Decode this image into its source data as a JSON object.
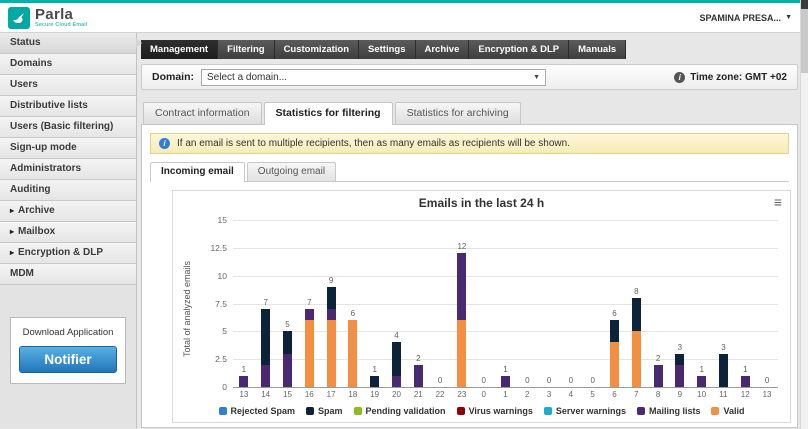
{
  "brand": {
    "name": "Parla",
    "tagline": "Secure Cloud Email",
    "account": "SPAMINA PRESA...",
    "accent": "#00b2ab"
  },
  "icons": {
    "caret_down": "▼",
    "expand_arrow": "▸",
    "chart_menu": "≡",
    "info": "i"
  },
  "sidebar": {
    "items": [
      {
        "label": "Status"
      },
      {
        "label": "Domains"
      },
      {
        "label": "Users"
      },
      {
        "label": "Distributive lists"
      },
      {
        "label": "Users (Basic filtering)"
      },
      {
        "label": "Sign-up mode"
      },
      {
        "label": "Administrators"
      },
      {
        "label": "Auditing"
      },
      {
        "label": "Archive"
      },
      {
        "label": "Mailbox"
      },
      {
        "label": "Encryption & DLP"
      },
      {
        "label": "MDM"
      }
    ],
    "download": {
      "title": "Download Application",
      "button": "Notifier"
    }
  },
  "nav": {
    "tabs": [
      {
        "label": "Management"
      },
      {
        "label": "Filtering"
      },
      {
        "label": "Customization"
      },
      {
        "label": "Settings"
      },
      {
        "label": "Archive"
      },
      {
        "label": "Encryption & DLP"
      },
      {
        "label": "Manuals"
      }
    ]
  },
  "domain_bar": {
    "label": "Domain:",
    "select_value": "Select a domain...",
    "timezone": "Time zone: GMT +02"
  },
  "tabs": [
    {
      "label": "Contract information"
    },
    {
      "label": "Statistics for filtering"
    },
    {
      "label": "Statistics for archiving"
    }
  ],
  "notice": "If an email is sent to multiple recipients, then as many emails as recipients will be shown.",
  "subtabs": [
    {
      "label": "Incoming email"
    },
    {
      "label": "Outgoing email"
    }
  ],
  "chart_data": {
    "type": "bar",
    "stacked": true,
    "title": "Emails in the last 24 h",
    "xlabel": "",
    "ylabel": "Total of analyzed emails",
    "ylim": [
      0,
      15
    ],
    "yticks": [
      "0",
      "2.5",
      "5",
      "7.5",
      "10",
      "12.5",
      "15"
    ],
    "grid": true,
    "legend_position": "bottom",
    "categories": [
      "13",
      "14",
      "15",
      "16",
      "17",
      "18",
      "19",
      "20",
      "21",
      "22",
      "23",
      "0",
      "1",
      "2",
      "3",
      "4",
      "5",
      "6",
      "7",
      "8",
      "9",
      "10",
      "11",
      "12",
      "13"
    ],
    "totals": [
      1,
      7,
      5,
      7,
      9,
      6,
      1,
      4,
      2,
      0,
      12,
      0,
      1,
      0,
      0,
      0,
      0,
      6,
      8,
      2,
      3,
      1,
      3,
      1,
      0
    ],
    "series": [
      {
        "name": "Rejected Spam",
        "color": "#2f7ed8",
        "values": [
          0,
          0,
          0,
          0,
          0,
          0,
          0,
          0,
          0,
          0,
          0,
          0,
          0,
          0,
          0,
          0,
          0,
          0,
          0,
          0,
          0,
          0,
          0,
          0,
          0
        ]
      },
      {
        "name": "Spam",
        "color": "#0d233a",
        "values": [
          0,
          5,
          2,
          0,
          2,
          0,
          1,
          3,
          0,
          0,
          0,
          0,
          0,
          0,
          0,
          0,
          0,
          2,
          3,
          0,
          1,
          0,
          3,
          0,
          0
        ]
      },
      {
        "name": "Pending validation",
        "color": "#8bbc21",
        "values": [
          0,
          0,
          0,
          0,
          0,
          0,
          0,
          0,
          0,
          0,
          0,
          0,
          0,
          0,
          0,
          0,
          0,
          0,
          0,
          0,
          0,
          0,
          0,
          0,
          0
        ]
      },
      {
        "name": "Virus warnings",
        "color": "#910000",
        "values": [
          0,
          0,
          0,
          0,
          0,
          0,
          0,
          0,
          0,
          0,
          0,
          0,
          0,
          0,
          0,
          0,
          0,
          0,
          0,
          0,
          0,
          0,
          0,
          0,
          0
        ]
      },
      {
        "name": "Server warnings",
        "color": "#1aadce",
        "values": [
          0,
          0,
          0,
          0,
          0,
          0,
          0,
          0,
          0,
          0,
          0,
          0,
          0,
          0,
          0,
          0,
          0,
          0,
          0,
          0,
          0,
          0,
          0,
          0,
          0
        ]
      },
      {
        "name": "Mailing lists",
        "color": "#492970",
        "values": [
          1,
          2,
          3,
          1,
          1,
          0,
          0,
          1,
          2,
          0,
          6,
          0,
          1,
          0,
          0,
          0,
          0,
          0,
          0,
          2,
          2,
          1,
          0,
          1,
          0
        ]
      },
      {
        "name": "Valid",
        "color": "#f28f43",
        "values": [
          0,
          0,
          0,
          6,
          6,
          6,
          0,
          0,
          0,
          0,
          6,
          0,
          0,
          0,
          0,
          0,
          0,
          4,
          5,
          0,
          0,
          0,
          0,
          0,
          0
        ]
      }
    ]
  }
}
